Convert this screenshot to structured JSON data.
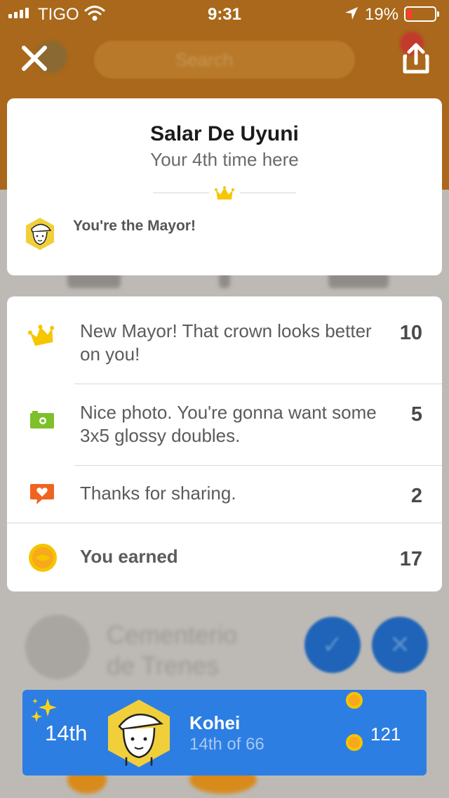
{
  "status_bar": {
    "carrier": "TIGO",
    "time": "9:31",
    "battery": "19%"
  },
  "background": {
    "search_placeholder": "Search",
    "place_name_line1": "Cementerio",
    "place_name_line2": "de Trenes"
  },
  "venue": {
    "name": "Salar De Uyuni",
    "visits": "Your 4th time here",
    "mayor_text": "You're the Mayor!"
  },
  "points": {
    "rows": [
      {
        "icon": "crown-icon",
        "text": "New Mayor! That crown looks better on you!",
        "value": "10"
      },
      {
        "icon": "camera-icon",
        "text": "Nice photo. You're gonna want some 3x5 glossy doubles.",
        "value": "5"
      },
      {
        "icon": "heart-chat-icon",
        "text": "Thanks for sharing.",
        "value": "2"
      }
    ],
    "total_label": "You earned",
    "total_value": "17"
  },
  "leaderboard": {
    "rank": "14th",
    "name": "Kohei",
    "sub": "14th of 66",
    "coins": "121"
  },
  "colors": {
    "header": "#a9681b",
    "leader_bar": "#2d7ee3",
    "coin": "#f5c400",
    "camera": "#7dc02a",
    "heart": "#f0641f"
  }
}
